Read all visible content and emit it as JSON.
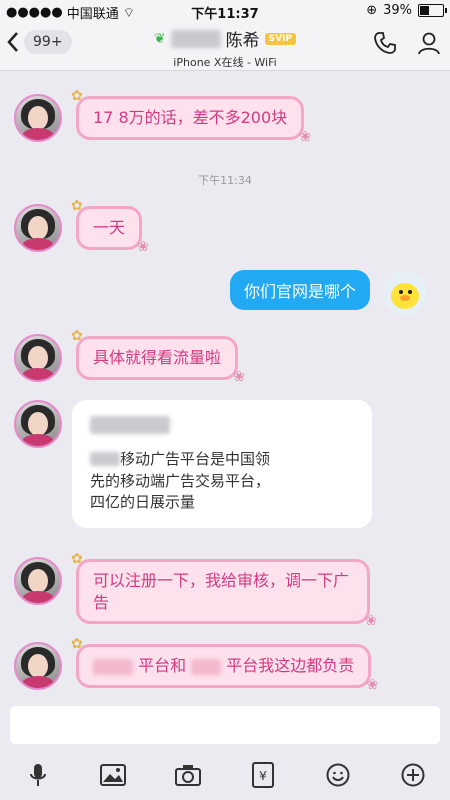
{
  "status_bar": {
    "carrier": "中国联通",
    "time": "下午11:37",
    "battery": "39%",
    "battery_level": 0.39
  },
  "nav": {
    "back_badge": "99+",
    "contact_name": "陈希",
    "svip_badge": "SVIP",
    "subtitle": "iPhone X在线 - WiFi"
  },
  "messages": {
    "m1": "17 8万的话，差不多200块",
    "timestamp": "下午11:34",
    "m2": "一天",
    "m3": "你们官网是哪个",
    "m4": "具体就得看流量啦",
    "m5": {
      "text": "移动广告平台是中国领先的移动端广告交易平台，四亿的日展示量"
    },
    "m6": "可以注册一下，我给审核，调一下广告",
    "m7_part1": "平台和",
    "m7_part2": "平台我这边都负责"
  },
  "icons": {
    "back": "chevron-left-icon",
    "phone": "phone-icon",
    "profile": "person-icon",
    "voice": "microphone-icon",
    "image": "image-icon",
    "camera": "camera-icon",
    "redpacket": "red-packet-icon",
    "emoji": "smiley-icon",
    "more": "plus-icon"
  }
}
